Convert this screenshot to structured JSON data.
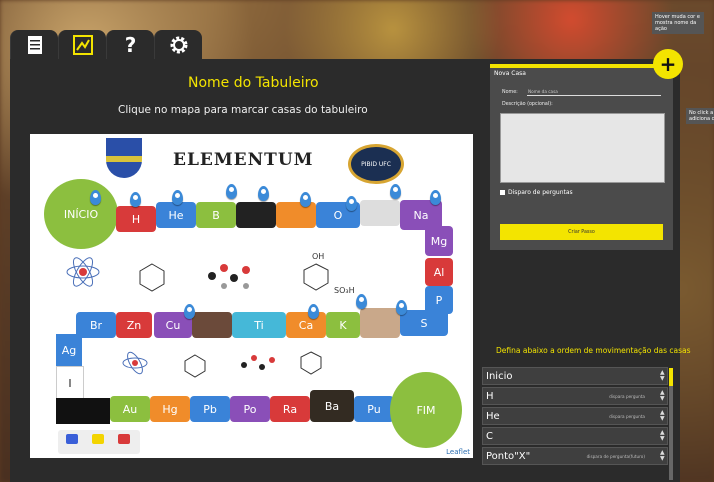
{
  "tabs": [
    {
      "icon": "document-icon"
    },
    {
      "icon": "map-icon"
    },
    {
      "icon": "help-icon",
      "label": "?"
    },
    {
      "icon": "gear-icon"
    }
  ],
  "board_title": "Nome do Tabuleiro",
  "map_instruction": "Clique no mapa para marcar casas do tabuleiro",
  "map": {
    "game_title": "ELEMENTUM",
    "labo_text": "PIBID UFC",
    "start": "INÍCIO",
    "end": "FIM",
    "cells_row1": [
      "H",
      "He",
      "B",
      "",
      "",
      "O",
      "",
      "Na"
    ],
    "cells_right": [
      "Mg",
      "Al",
      "P",
      "S"
    ],
    "cells_row2": [
      "Br",
      "Zn",
      "Cu",
      "",
      "Ti",
      "Ca",
      "K",
      ""
    ],
    "cells_left": [
      "Ag",
      "I"
    ],
    "cells_row3": [
      "Au",
      "Hg",
      "Pb",
      "Po",
      "Ra",
      "Ba",
      "Pu"
    ],
    "so3h": "SO₃H",
    "oh": "OH",
    "attribution": "Leaflet"
  },
  "new_case": {
    "title": "Nova Casa",
    "name_label": "Nome:",
    "name_value": "Nome da casa",
    "description_label": "Descrição (opcional):",
    "checkbox_label": "Disparo de perguntas",
    "create_button": "Criar Passo"
  },
  "tooltips": {
    "plus": "Hover muda cor e mostra nome da ação",
    "map": "No click a adiciona c"
  },
  "order": {
    "title": "Defina abaixo a ordem de movimentação das casas",
    "items": [
      {
        "name": "Inicio",
        "note": ""
      },
      {
        "name": "H",
        "note": "dispara pergunta"
      },
      {
        "name": "He",
        "note": "dispara pergunta"
      },
      {
        "name": "C",
        "note": ""
      },
      {
        "name": "Ponto\"X\"",
        "note": "dispara de pergunta(futuro)"
      }
    ]
  },
  "colors": {
    "accent": "#f3e400",
    "panel": "#2b2b2b",
    "start_green": "#8cbf3f"
  }
}
